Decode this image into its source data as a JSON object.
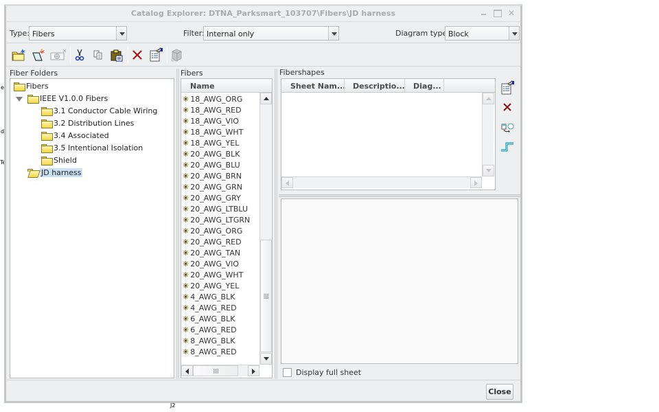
{
  "window": {
    "title": "Catalog Explorer: DTNA_Parksmart_103707\\Fibers\\JD harness"
  },
  "filters": {
    "type_label": "Type:",
    "type_value": "Fibers",
    "filter_label": "Filter:",
    "filter_value": "Internal only",
    "diagram_type_label": "Diagram type:",
    "diagram_type_value": "Block"
  },
  "toolbar": {
    "buttons": [
      "new-folder",
      "new-fiber",
      "new-fibershape",
      "cut",
      "copy",
      "paste",
      "delete",
      "properties",
      "component"
    ]
  },
  "fiber_folders": {
    "title": "Fiber Folders",
    "items": [
      {
        "label": "Fibers",
        "level": 0,
        "expanded": false
      },
      {
        "label": "IEEE V1.0.0 Fibers",
        "level": 1,
        "expanded": true
      },
      {
        "label": "3.1 Conductor Cable Wiring",
        "level": 2
      },
      {
        "label": "3.2 Distribution Lines",
        "level": 2
      },
      {
        "label": "3.4 Associated",
        "level": 2
      },
      {
        "label": "3.5 Intentional Isolation",
        "level": 2
      },
      {
        "label": "Shield",
        "level": 2
      },
      {
        "label": "JD harness",
        "level": 1,
        "selected": true
      }
    ]
  },
  "fibers": {
    "title": "Fibers",
    "column_header": "Name",
    "items": [
      "18_AWG_ORG",
      "18_AWG_RED",
      "18_AWG_VIO",
      "18_AWG_WHT",
      "18_AWG_YEL",
      "20_AWG_BLK",
      "20_AWG_BLU",
      "20_AWG_BRN",
      "20_AWG_GRN",
      "20_AWG_GRY",
      "20_AWG_LTBLU",
      "20_AWG_LTGRN",
      "20_AWG_ORG",
      "20_AWG_RED",
      "20_AWG_TAN",
      "20_AWG_VIO",
      "20_AWG_WHT",
      "20_AWG_YEL",
      "4_AWG_BLK",
      "4_AWG_RED",
      "6_AWG_BLK",
      "6_AWG_RED",
      "8_AWG_BLK",
      "8_AWG_RED"
    ]
  },
  "fibershapes": {
    "title": "Fibershapes",
    "columns": [
      "Sheet Nam...",
      "Descriptio...",
      "Diag..."
    ],
    "rows": [],
    "side_buttons": [
      "properties",
      "delete",
      "replace",
      "step-shape"
    ]
  },
  "preview": {
    "display_full_sheet_label": "Display full sheet",
    "display_full_sheet_checked": false
  },
  "footer": {
    "close_label": "Close"
  },
  "stray_glyphs": [
    "e",
    "d",
    "Te",
    "J2"
  ]
}
